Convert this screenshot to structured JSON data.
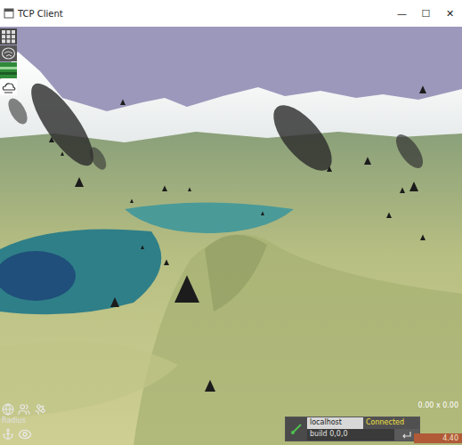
{
  "window": {
    "title": "TCP Client",
    "controls": [
      "—",
      "☐",
      "✕"
    ]
  },
  "overlay": {
    "radius_label": "Radius",
    "coords": "0.00 x 0.00",
    "value": "4.40"
  },
  "connection": {
    "host": "localhost",
    "status": "Connected",
    "build": "build 0,0,0"
  }
}
